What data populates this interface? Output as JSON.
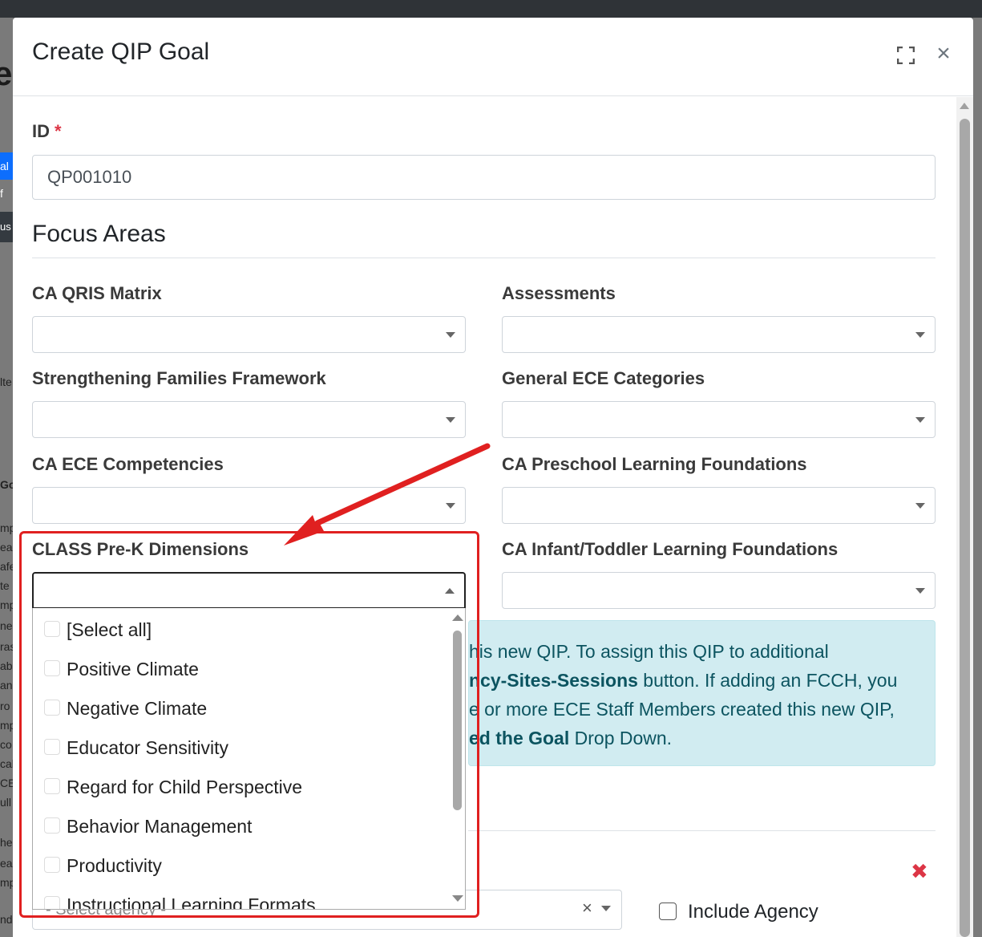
{
  "background": {
    "fragments": [
      "e",
      "al f",
      "us",
      "lte",
      "Go",
      "mp",
      "ea",
      "afe",
      "te",
      "mp",
      "ne",
      "ras",
      "abl",
      "an",
      "ro",
      "mp",
      "co",
      "cal",
      "CE",
      "ull",
      "he",
      "ea",
      "mp",
      "nd"
    ]
  },
  "modal": {
    "title": "Create QIP Goal",
    "maximize_icon": "maximize-icon",
    "close_icon": "×"
  },
  "form": {
    "id_label": "ID",
    "required_mark": "*",
    "id_value": "QP001010",
    "section_title": "Focus Areas",
    "fields": [
      {
        "label": "CA QRIS Matrix",
        "value": ""
      },
      {
        "label": "Assessments",
        "value": ""
      },
      {
        "label": "Strengthening Families Framework",
        "value": ""
      },
      {
        "label": "General ECE Categories",
        "value": ""
      },
      {
        "label": "CA ECE Competencies",
        "value": ""
      },
      {
        "label": "CA Preschool Learning Foundations",
        "value": ""
      },
      {
        "label": "CLASS Pre-K Dimensions",
        "value": "",
        "open": true
      },
      {
        "label": "CA Infant/Toddler Learning Foundations",
        "value": ""
      }
    ]
  },
  "dropdown": {
    "options": [
      {
        "label": "[Select all]",
        "checked": false
      },
      {
        "label": "Positive Climate",
        "checked": false
      },
      {
        "label": "Negative Climate",
        "checked": false
      },
      {
        "label": "Educator Sensitivity",
        "checked": false
      },
      {
        "label": "Regard for Child Perspective",
        "checked": false
      },
      {
        "label": "Behavior Management",
        "checked": false
      },
      {
        "label": "Productivity",
        "checked": false
      },
      {
        "label": "Instructional Learning Formats",
        "checked": false
      }
    ]
  },
  "info_box": {
    "line1": "his new QIP. To assign this QIP to additional",
    "line2_bold": "ncy-Sites-Sessions",
    "line2_rest": " button. If adding an FCCH, you",
    "line3": "e or more ECE Staff Members created this new QIP,",
    "line4_bold": "ed the Goal",
    "line4_rest": " Drop Down."
  },
  "agency": {
    "placeholder": "- Select agency -",
    "clear_icon": "×",
    "include_label": "Include Agency",
    "remove_icon": "✖"
  },
  "colors": {
    "accent_red": "#e02020",
    "info_bg": "#d1ecf1",
    "info_text": "#0c5460",
    "required": "#dc3545"
  }
}
